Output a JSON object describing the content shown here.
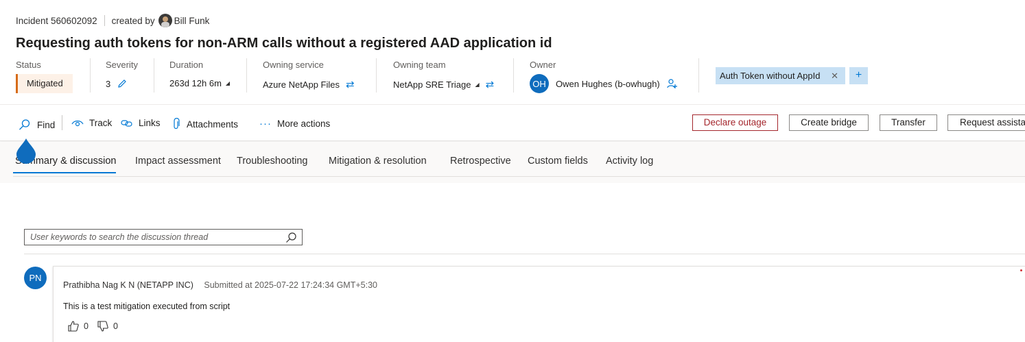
{
  "header": {
    "incident_label": "Incident 560602092",
    "created_by_label": "created by",
    "creator_name": "Bill Funk",
    "title": "Requesting auth tokens for non-ARM calls without a registered AAD application id"
  },
  "fields": {
    "status": {
      "label": "Status",
      "value": "Mitigated",
      "color": "#d66b19"
    },
    "severity": {
      "label": "Severity",
      "value": "3"
    },
    "duration": {
      "label": "Duration",
      "value": "263d 12h 6m"
    },
    "owning_service": {
      "label": "Owning service",
      "value": "Azure NetApp Files"
    },
    "owning_team": {
      "label": "Owning team",
      "value": "NetApp SRE Triage"
    },
    "owner": {
      "label": "Owner",
      "initials": "OH",
      "value": "Owen Hughes (b-owhugh)"
    }
  },
  "tags": [
    {
      "label": "Auth Token without AppId"
    }
  ],
  "toolbar": {
    "find": "Find",
    "track": "Track",
    "links": "Links",
    "attachments": "Attachments",
    "more_actions": "More actions",
    "declare_outage": "Declare outage",
    "create_bridge": "Create bridge",
    "transfer": "Transfer",
    "request_assistance": "Request assistan"
  },
  "tabs": [
    {
      "label": "Summary & discussion",
      "active": true
    },
    {
      "label": "Impact assessment"
    },
    {
      "label": "Troubleshooting"
    },
    {
      "label": "Mitigation & resolution"
    },
    {
      "label": "Retrospective"
    },
    {
      "label": "Custom fields"
    },
    {
      "label": "Activity log"
    }
  ],
  "discussion": {
    "search_placeholder": "User keywords to search the discussion thread",
    "entries": [
      {
        "initials": "PN",
        "author": "Prathibha Nag K N (NETAPP INC)",
        "submitted": "Submitted at 2025-07-22 17:24:34 GMT+5:30",
        "text": "This is a test mitigation executed from script",
        "likes": "0",
        "dislikes": "0"
      }
    ]
  },
  "colors": {
    "accent": "#0078d4",
    "danger": "#a4262c",
    "tag_bg": "#c7e0f4"
  }
}
